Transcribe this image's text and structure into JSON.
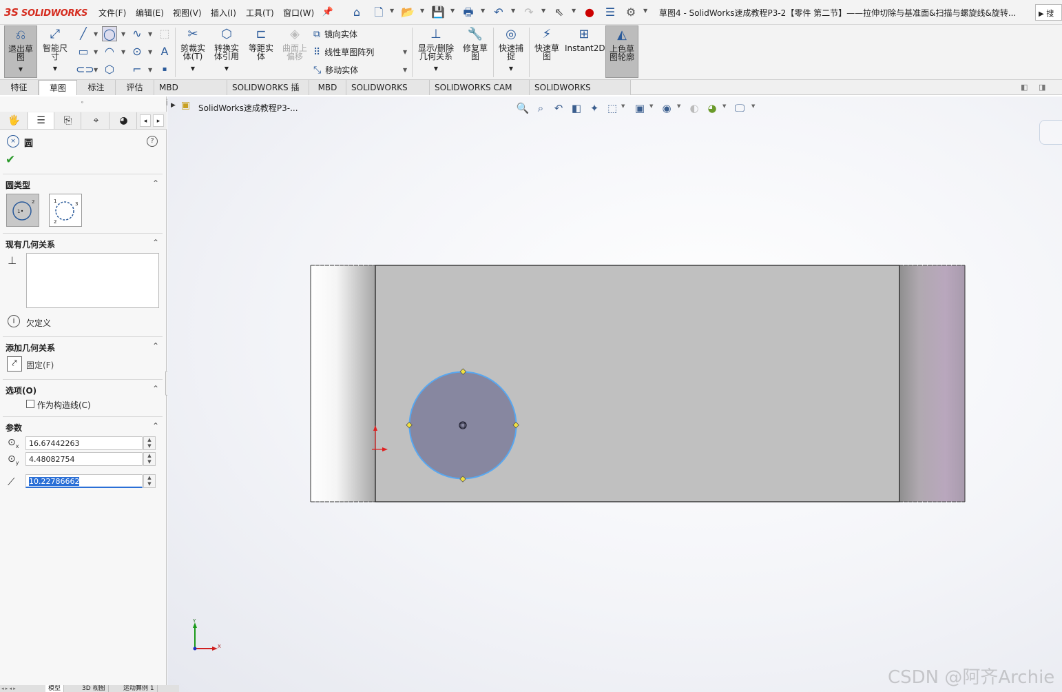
{
  "app": {
    "logo_ds": "3S",
    "logo": "SOLIDWORKS",
    "window_title": "草图4 - SolidWorks速成教程P3-2【零件 第二节】——拉伸切除与基准面&扫描与螺旋线&旋转...",
    "search": "搜"
  },
  "menus": [
    "文件(F)",
    "编辑(E)",
    "视图(V)",
    "插入(I)",
    "工具(T)",
    "窗口(W)"
  ],
  "ribbon": {
    "exit_sketch": [
      "退出草",
      "图"
    ],
    "smart_dim": [
      "智能尺",
      "寸"
    ],
    "trim": [
      "剪裁实",
      "体(T)"
    ],
    "convert": [
      "转换实",
      "体引用"
    ],
    "offset": [
      "等距实",
      "体"
    ],
    "surface_offset": [
      "曲面上",
      "偏移"
    ],
    "mirror": "镜向实体",
    "linear_pattern": "线性草图阵列",
    "move": "移动实体",
    "show_relations": [
      "显示/删除",
      "几何关系"
    ],
    "repair": [
      "修复草",
      "图"
    ],
    "quick_snap": [
      "快速捕",
      "捉"
    ],
    "rapid_sketch": [
      "快速草",
      "图"
    ],
    "instant2d": "Instant2D",
    "shaded_contour": [
      "上色草",
      "图轮廓"
    ]
  },
  "cmd_tabs": [
    "特征",
    "草图",
    "标注",
    "评估",
    "MBD Dimensions",
    "SOLIDWORKS 插件",
    "MBD",
    "SOLIDWORKS CAM",
    "SOLIDWORKS CAM TBM",
    "SOLIDWORKS Inspection"
  ],
  "cmd_tab_active": "草图",
  "tree_path": "SolidWorks速成教程P3-...",
  "pm": {
    "title": "圆",
    "circle_type": "圆类型",
    "existing_rel": "现有几何关系",
    "status": "欠定义",
    "add_rel": "添加几何关系",
    "fix": "固定(F)",
    "options": "选项(O)",
    "construction": "作为构造线(C)",
    "params": "参数",
    "x": "16.67442263",
    "y": "4.48082754",
    "r": "10.22786662"
  },
  "bottom_tabs": [
    "模型",
    "3D 视图",
    "运动算例 1"
  ],
  "triad": {
    "x": "X",
    "y": "Y"
  },
  "watermark": "CSDN @阿齐Archie"
}
